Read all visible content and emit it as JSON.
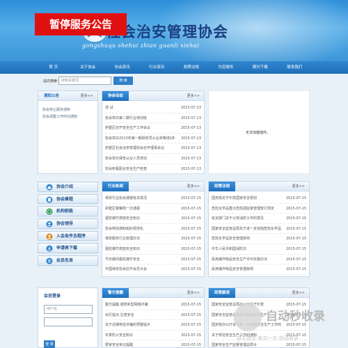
{
  "header": {
    "notice_badge": "暂停服务公告",
    "title": "社会治安管理协会",
    "subtitle": "gongshuqu shehui zhian guanli xiehui"
  },
  "nav": {
    "items": [
      "首 页",
      "关于协会",
      "协会资讯",
      "行业资讯",
      "政策法规",
      "为您服务",
      "期刊下载",
      "联系我们"
    ]
  },
  "search": {
    "label": "站内搜索：",
    "placeholder": "搜索关键词",
    "button": "搜 索"
  },
  "notice_panel": {
    "title": "通知公告",
    "more": "更多>>",
    "items": [
      "协会停止服务通知",
      "协会调整工作时间通知"
    ]
  },
  "news_panel": {
    "title": "协会动态",
    "more": "更多>>",
    "items": [
      {
        "title": "测 试",
        "date": "2015-07-13"
      },
      {
        "title": "协会举办第二期行业培训班",
        "date": "2015-07-13"
      },
      {
        "title": "拱墅区召开安全生产工作会议",
        "date": "2015-07-13"
      },
      {
        "title": "协会举办2013年第一期保安员从业资格培训班",
        "date": "2015-07-13"
      },
      {
        "title": "拱墅区社会治安管理协会召开理事会议",
        "date": "2015-07-13"
      },
      {
        "title": "协会举办保安从业人员培训",
        "date": "2015-07-13"
      },
      {
        "title": "协会积极配合安全生产检查",
        "date": "2015-07-13"
      }
    ]
  },
  "nodata": "无法加载插件。",
  "side_menu": {
    "items": [
      "协会介绍",
      "协会章程",
      "机构职能",
      "协会领导",
      "入会条件及程序",
      "申请表下载",
      "会员名单"
    ]
  },
  "industry_panel": {
    "title": "行业新闻",
    "more": "更多>>",
    "items": [
      {
        "title": "保安行业协会通报有关情况",
        "date": "2015-07-15"
      },
      {
        "title": "拱墅区警察局一次通报",
        "date": "2015-07-15"
      },
      {
        "title": "烟花爆竹燃放安全知识",
        "date": "2015-07-15"
      },
      {
        "title": "协会特别通知组织规范化",
        "date": "2015-07-15"
      },
      {
        "title": "保安服务行业管理办法",
        "date": "2015-07-15"
      },
      {
        "title": "烟花爆竹燃放安全知识",
        "date": "2015-07-15"
      },
      {
        "title": "节日期间烟花爆竹安全",
        "date": "2015-07-15"
      },
      {
        "title": "中国保安协会召开会员大会",
        "date": "2015-07-15"
      }
    ]
  },
  "policy_panel": {
    "title": "政策法规",
    "more": "更多>>",
    "items": [
      {
        "title": "国务院关于印发国家安全规划",
        "date": "2015-07-15"
      },
      {
        "title": "危险化学品重大危险源监督管理暂行规定",
        "date": "2015-07-15"
      },
      {
        "title": "有关部门关于公安消防工作的意见",
        "date": "2015-07-15"
      },
      {
        "title": "国家安全监管总局关于进一步加强危险化学品",
        "date": "2015-07-15"
      },
      {
        "title": "危险化学品安全管理条例",
        "date": "2015-07-15"
      },
      {
        "title": "中华人民共和国消防法",
        "date": "2015-07-15"
      },
      {
        "title": "民用爆炸物品安全生产许可实施办法",
        "date": "2015-07-15"
      },
      {
        "title": "民用爆炸物品安全管理条例",
        "date": "2015-07-15"
      }
    ]
  },
  "member_panel": {
    "title": "会员登录",
    "username_placeholder": "用户名",
    "password_placeholder": "",
    "login": "登 录"
  },
  "safety_panel": {
    "title": "警方提醒",
    "more": "更多>>",
    "items": [
      {
        "title": "警方提醒:谨防新型网络诈骗",
        "date": "2015-07-15"
      },
      {
        "title": "出行提示,注意安全",
        "date": "2015-07-15"
      },
      {
        "title": "关于近期电信诈骗的预警提示",
        "date": "2015-07-15"
      },
      {
        "title": "冬季防火安全知识",
        "date": "2015-07-15"
      },
      {
        "title": "居家安全常识提醒",
        "date": "2015-07-15"
      }
    ]
  },
  "policy2_panel": {
    "title": "政策解读",
    "more": "更多>>",
    "items": [
      {
        "title": "国家安全监管总局办公厅关于印发",
        "date": "2015-07-15"
      },
      {
        "title": "国家安全监管总局关于加强安全生产",
        "date": "2015-07-15"
      },
      {
        "title": "国务院办公厅关于进一步加强安全生产工作的意见",
        "date": "2015-07-15"
      },
      {
        "title": "关于规范安全生产工作的通知",
        "date": "2015-07-15"
      },
      {
        "title": "国家安全生产监督管理总局令",
        "date": "2015-07-15"
      }
    ]
  },
  "watermark": {
    "text": "自动秒收录",
    "sub": "自主提交·来访一次·自动收录"
  }
}
